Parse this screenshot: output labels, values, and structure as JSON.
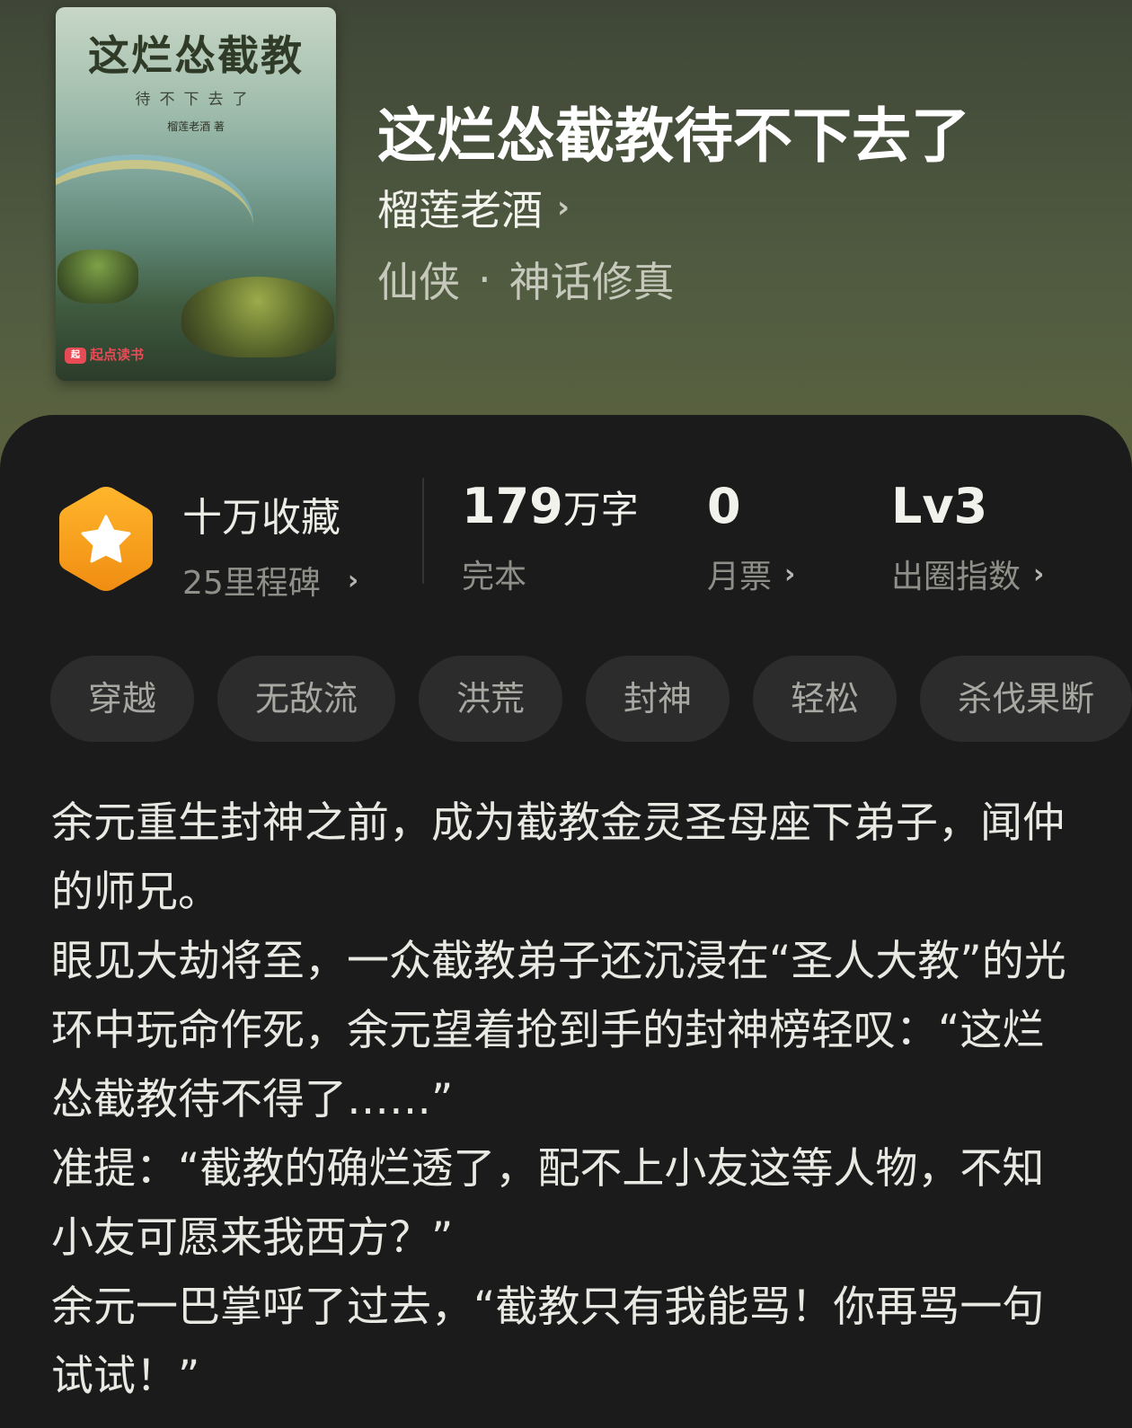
{
  "book": {
    "cover": {
      "title": "这烂怂截教",
      "subtitle": "待不下去了",
      "author": "榴莲老酒 著",
      "publisher_logo": "起点读书"
    },
    "title": "这烂怂截教待不下去了",
    "author": "榴莲老酒",
    "genre": "仙侠",
    "subgenre": "神话修真",
    "genre_separator": "·"
  },
  "stats": {
    "milestone_title": "十万收藏",
    "milestone_sub": "25里程碑",
    "word_count": "179",
    "word_unit": "万字",
    "status": "完本",
    "monthly_tickets": "0",
    "monthly_tickets_label": "月票",
    "breakout_level": "Lv3",
    "breakout_label": "出圈指数"
  },
  "tags": [
    "穿越",
    "无敌流",
    "洪荒",
    "封神",
    "轻松",
    "杀伐果断"
  ],
  "description": "余元重生封神之前，成为截教金灵圣母座下弟子，闻仲的师兄。\n眼见大劫将至，一众截教弟子还沉浸在“圣人大教”的光环中玩命作死，余元望着抢到手的封神榜轻叹：“这烂怂截教待不得了……”\n准提：“截教的确烂透了，配不上小友这等人物，不知小友可愿来我西方？”\n余元一巴掌呼了过去，“截教只有我能骂！你再骂一句试试！”",
  "colors": {
    "panel_bg": "#1b1b1b",
    "badge_orange": "#f7a21b",
    "tag_bg": "#2c2c2c"
  },
  "icons": {
    "badge": "star-hexagon-icon",
    "chevron": "chevron-right-icon"
  }
}
